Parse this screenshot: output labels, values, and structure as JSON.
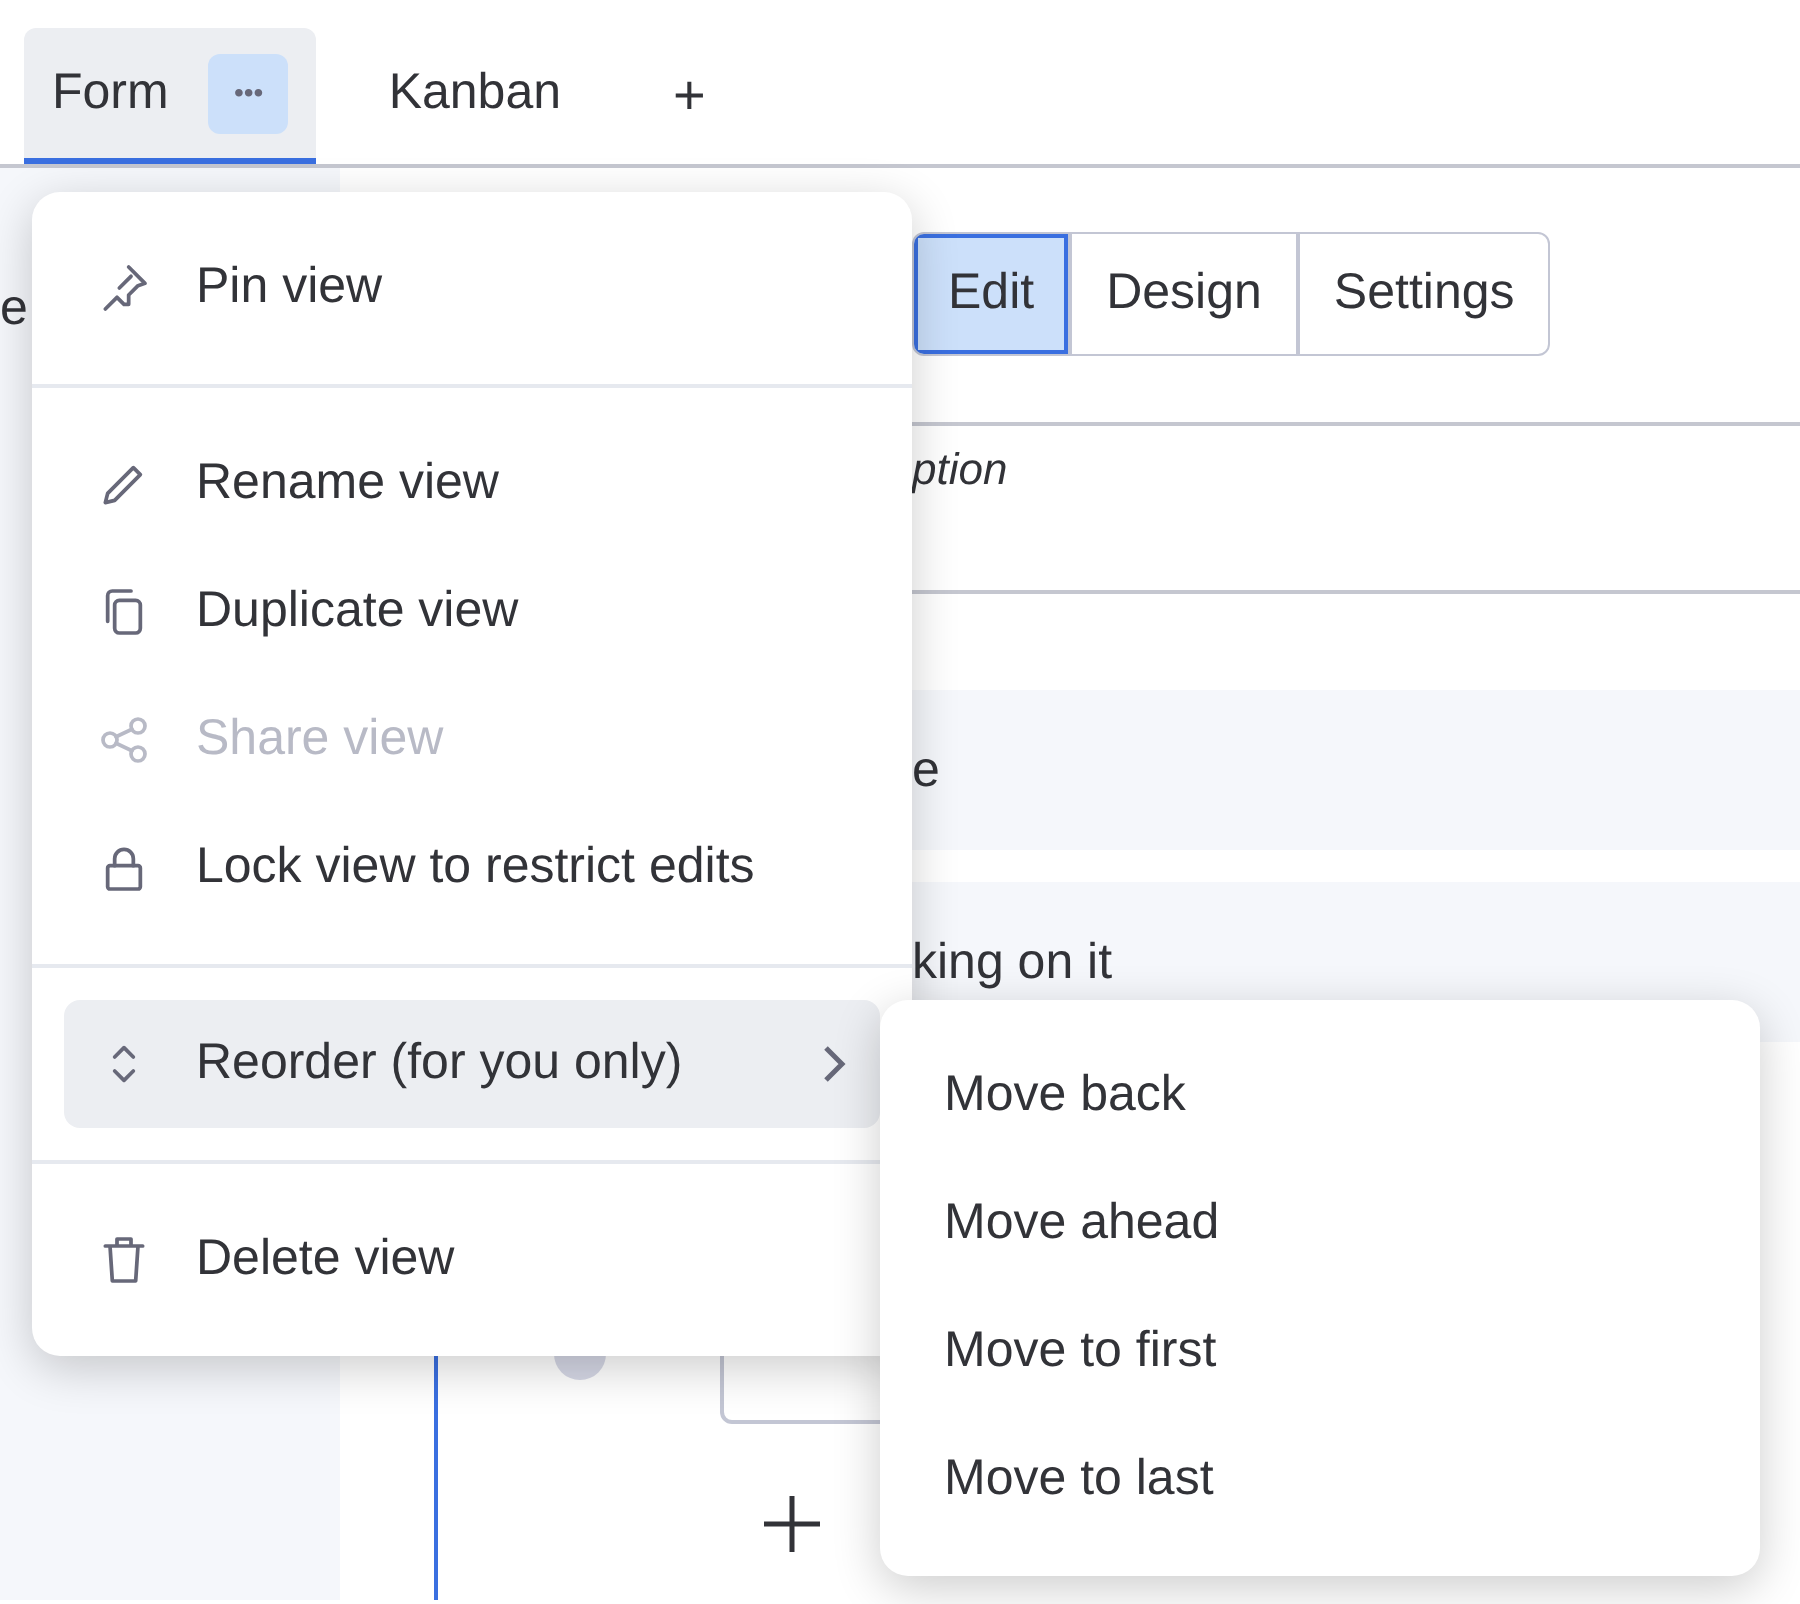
{
  "view_tabs": [
    {
      "label": "Form",
      "selected": true,
      "menu_button": "•••"
    },
    {
      "label": "Kanban",
      "selected": false
    }
  ],
  "add_tab": "+",
  "background": {
    "left_fragment": "e",
    "mode_tabs": [
      {
        "label": "Edit",
        "selected": true
      },
      {
        "label": "Design",
        "selected": false
      },
      {
        "label": "Settings",
        "selected": false
      }
    ],
    "description_fragment": "ption",
    "option_rows": [
      "e",
      "king on it"
    ]
  },
  "view_menu": {
    "sections": [
      [
        {
          "label": "Pin view",
          "disabled": false,
          "highlighted": false,
          "has_submenu": false
        }
      ],
      [
        {
          "label": "Rename view",
          "disabled": false,
          "highlighted": false,
          "has_submenu": false
        },
        {
          "label": "Duplicate view",
          "disabled": false,
          "highlighted": false,
          "has_submenu": false
        },
        {
          "label": "Share view",
          "disabled": true,
          "highlighted": false,
          "has_submenu": false
        },
        {
          "label": "Lock view to restrict edits",
          "disabled": false,
          "highlighted": false,
          "has_submenu": false
        }
      ],
      [
        {
          "label": "Reorder (for you only)",
          "disabled": false,
          "highlighted": true,
          "has_submenu": true
        }
      ],
      [
        {
          "label": "Delete view",
          "disabled": false,
          "highlighted": false,
          "has_submenu": false
        }
      ]
    ]
  },
  "submenu": {
    "items": [
      "Move back",
      "Move ahead",
      "Move to first",
      "Move to last"
    ]
  }
}
